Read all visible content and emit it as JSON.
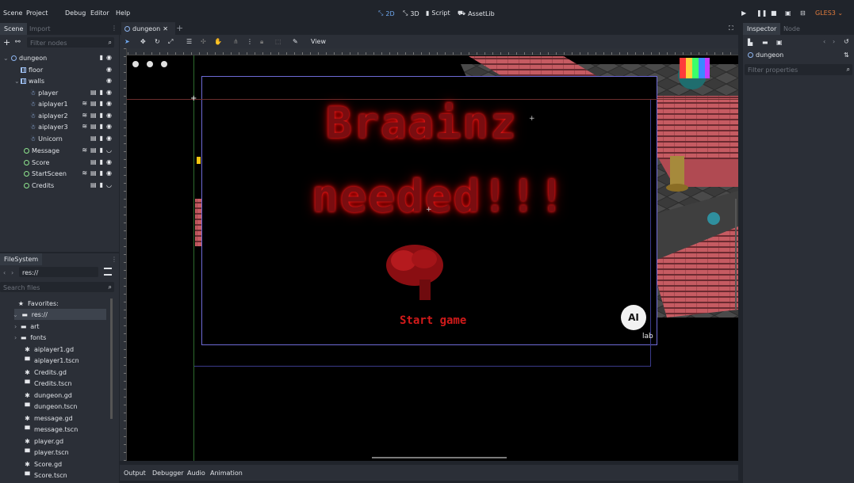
{
  "menu": {
    "items": [
      "Scene",
      "Project",
      "Debug",
      "Editor",
      "Help"
    ],
    "workspaces": [
      {
        "label": "2D",
        "icon": "2d-icon",
        "active": true
      },
      {
        "label": "3D",
        "icon": "3d-icon",
        "active": false
      },
      {
        "label": "Script",
        "icon": "script-icon",
        "active": false
      },
      {
        "label": "AssetLib",
        "icon": "assetlib-icon",
        "active": false
      }
    ],
    "renderer": "GLES3"
  },
  "scene_dock": {
    "tabs": [
      "Scene",
      "Import"
    ],
    "filter_placeholder": "Filter nodes",
    "tree": [
      {
        "name": "dungeon",
        "icon": "node2d-icon"
      },
      {
        "name": "floor",
        "icon": "tilemap-icon"
      },
      {
        "name": "walls",
        "icon": "tilemap-icon"
      },
      {
        "name": "player",
        "icon": "kinematic-icon"
      },
      {
        "name": "aiplayer1",
        "icon": "kinematic-icon"
      },
      {
        "name": "aiplayer2",
        "icon": "kinematic-icon"
      },
      {
        "name": "aiplayer3",
        "icon": "kinematic-icon"
      },
      {
        "name": "Unicorn",
        "icon": "kinematic-icon"
      },
      {
        "name": "Message",
        "icon": "control-icon"
      },
      {
        "name": "Score",
        "icon": "control-icon"
      },
      {
        "name": "StartSceen",
        "icon": "control-icon"
      },
      {
        "name": "Credits",
        "icon": "control-icon"
      }
    ]
  },
  "filesystem_dock": {
    "title": "FileSystem",
    "path": "res://",
    "search_placeholder": "Search files",
    "favorites_label": "Favorites:",
    "root": "res://",
    "items": [
      {
        "name": "art",
        "icon": "folder-icon"
      },
      {
        "name": "fonts",
        "icon": "folder-icon"
      },
      {
        "name": "aiplayer1.gd",
        "icon": "gear-icon"
      },
      {
        "name": "aiplayer1.tscn",
        "icon": "scene-icon"
      },
      {
        "name": "Credits.gd",
        "icon": "gear-icon"
      },
      {
        "name": "Credits.tscn",
        "icon": "scene-icon"
      },
      {
        "name": "dungeon.gd",
        "icon": "gear-icon"
      },
      {
        "name": "dungeon.tscn",
        "icon": "scene-icon"
      },
      {
        "name": "message.gd",
        "icon": "gear-icon"
      },
      {
        "name": "message.tscn",
        "icon": "scene-icon"
      },
      {
        "name": "player.gd",
        "icon": "gear-icon"
      },
      {
        "name": "player.tscn",
        "icon": "scene-icon"
      },
      {
        "name": "Score.gd",
        "icon": "gear-icon"
      },
      {
        "name": "Score.tscn",
        "icon": "scene-icon"
      }
    ]
  },
  "editor": {
    "tab_label": "dungeon",
    "view_menu": "View",
    "game_title_line1": "Braainz",
    "game_title_line2": "needed!!!",
    "start_button": "Start game",
    "logo_text": "AI",
    "logo_caption": "lab"
  },
  "bottom_panel": [
    "Output",
    "Debugger",
    "Audio",
    "Animation"
  ],
  "inspector": {
    "tabs": [
      "Inspector",
      "Node"
    ],
    "object_name": "dungeon",
    "filter_placeholder": "Filter properties"
  },
  "colors": {
    "accent": "#6fa8f0",
    "background": "#20242b",
    "panel": "#2b2f37",
    "title_red": "#c00000",
    "renderer_label": "#e07b3c"
  }
}
